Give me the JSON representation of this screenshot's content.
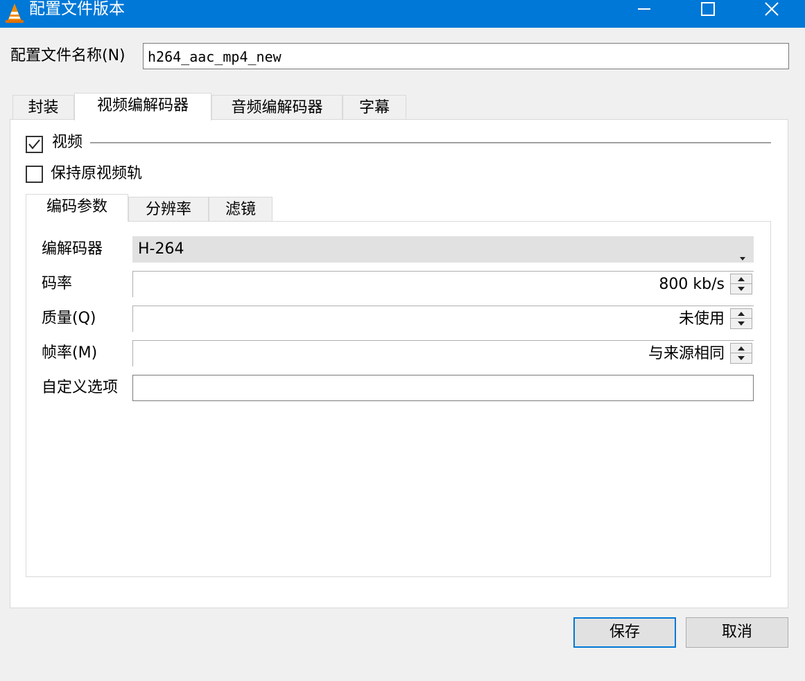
{
  "window": {
    "title": "配置文件版本",
    "icon": "vlc-cone-icon",
    "controls": [
      "minimize-icon",
      "maximize-icon",
      "close-icon"
    ]
  },
  "profile": {
    "name_label": "配置文件名称(N)",
    "name_value": "h264_aac_mp4_new"
  },
  "tabs": [
    {
      "label": "封装"
    },
    {
      "label": "视频编解码器",
      "active": true
    },
    {
      "label": "音频编解码器"
    },
    {
      "label": "字幕"
    }
  ],
  "video": {
    "video_checkbox_label": "视频",
    "video_checked": true,
    "keep_original_label": "保持原视频轨",
    "keep_original_checked": false,
    "subtabs": [
      {
        "label": "编码参数",
        "active": true
      },
      {
        "label": "分辨率"
      },
      {
        "label": "滤镜"
      }
    ],
    "codec_label": "编解码器",
    "codec_value": "H-264",
    "bitrate_label": "码率",
    "bitrate_value": "800 kb/s",
    "quality_label": "质量(Q)",
    "quality_value": "未使用",
    "framerate_label": "帧率(M)",
    "framerate_value": "与来源相同",
    "custom_label": "自定义选项",
    "custom_value": ""
  },
  "buttons": {
    "save": "保存",
    "cancel": "取消"
  },
  "colors": {
    "titlebar": "#0078d7",
    "default_button_border": "#0078d7"
  }
}
